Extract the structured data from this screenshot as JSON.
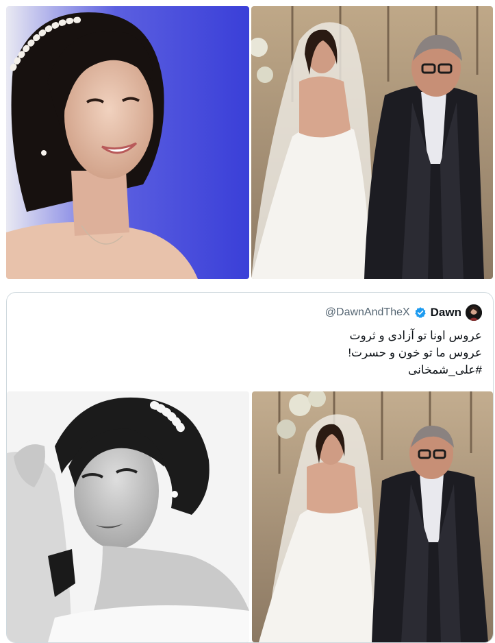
{
  "tweet": {
    "display_name": "Dawn",
    "handle": "@DawnAndTheX",
    "verified_icon": "verified-badge-icon",
    "lines": [
      "عروس اونا تو آزادی و ثروت",
      "عروس ما تو خون و حسرت!",
      "#علی_شمخانی"
    ]
  },
  "colors": {
    "verified_blue": "#1d9bf0",
    "handle_gray": "#536471",
    "border": "#cfd9de"
  }
}
